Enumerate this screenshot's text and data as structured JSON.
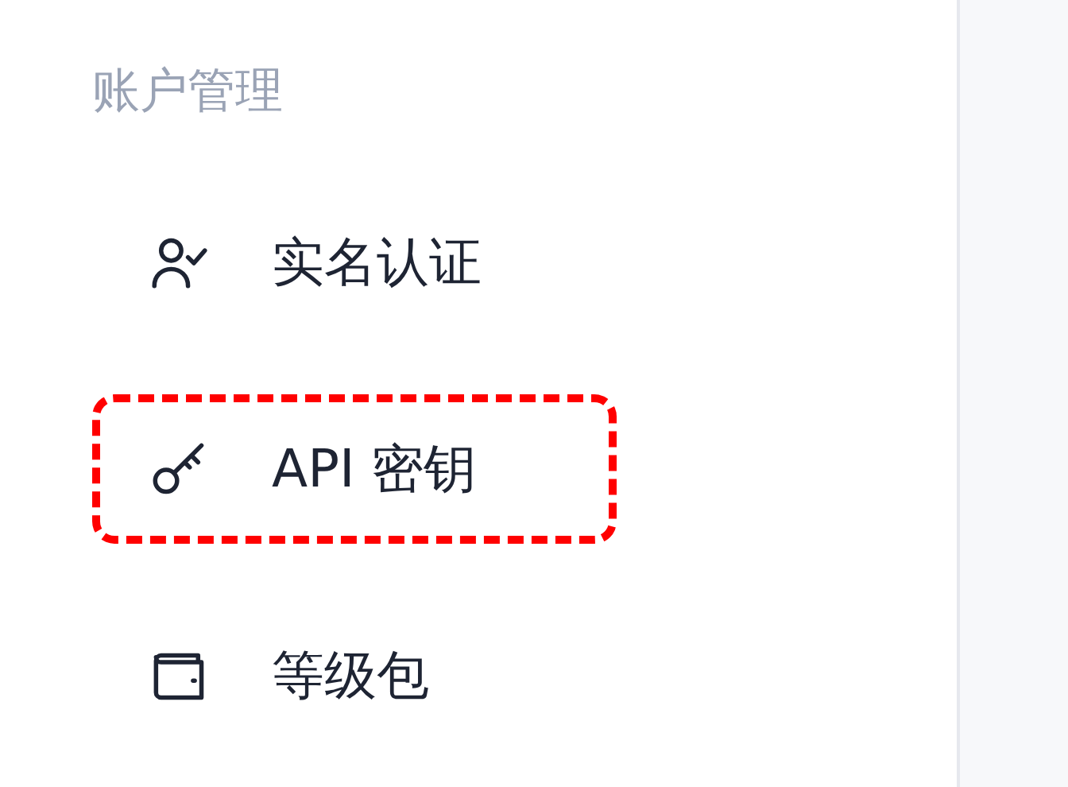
{
  "sidebar": {
    "section_title": "账户管理",
    "items": [
      {
        "kind": "verify",
        "label": "实名认证",
        "highlighted": false
      },
      {
        "kind": "key",
        "label": "API 密钥",
        "highlighted": true
      },
      {
        "kind": "wallet",
        "label": "等级包",
        "highlighted": false
      }
    ]
  }
}
